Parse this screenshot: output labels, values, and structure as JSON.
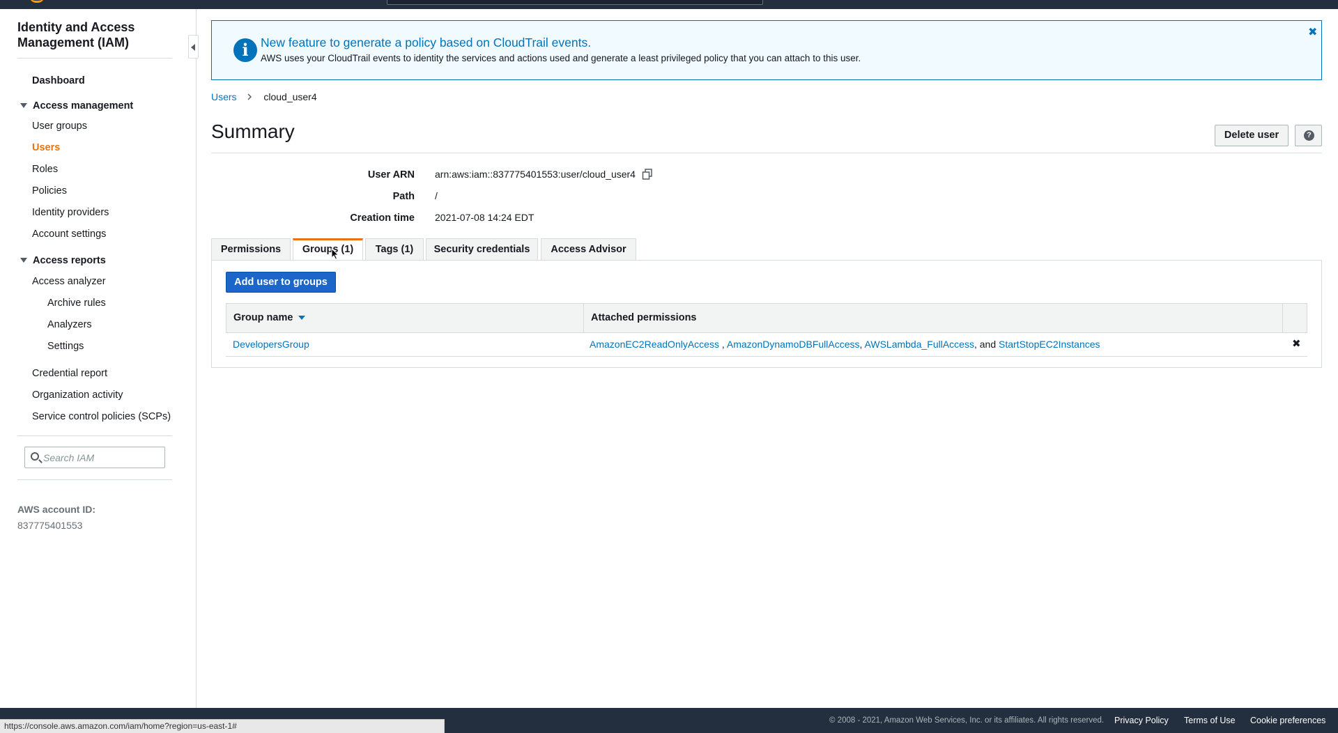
{
  "app": {
    "title": "Identity and Access Management (IAM)"
  },
  "sidebar": {
    "dashboard": "Dashboard",
    "access_management": {
      "label": "Access management",
      "items": [
        "User groups",
        "Users",
        "Roles",
        "Policies",
        "Identity providers",
        "Account settings"
      ],
      "active": "Users"
    },
    "access_reports": {
      "label": "Access reports",
      "items": [
        "Access analyzer",
        "Archive rules",
        "Analyzers",
        "Settings",
        "Credential report",
        "Organization activity",
        "Service control policies (SCPs)"
      ]
    },
    "search_placeholder": "Search IAM",
    "account_id_label": "AWS account ID:",
    "account_id": "837775401553"
  },
  "banner": {
    "title": "New feature to generate a policy based on CloudTrail events.",
    "text": "AWS uses your CloudTrail events to identity the services and actions used and generate a least privileged policy that you can attach to this user."
  },
  "breadcrumb": {
    "parent": "Users",
    "current": "cloud_user4"
  },
  "summary": {
    "title": "Summary",
    "delete_button": "Delete user",
    "help_button": "?",
    "fields": {
      "arn_label": "User ARN",
      "arn_value": "arn:aws:iam::837775401553:user/cloud_user4",
      "path_label": "Path",
      "path_value": "/",
      "created_label": "Creation time",
      "created_value": "2021-07-08 14:24 EDT"
    }
  },
  "tabs": {
    "permissions": "Permissions",
    "groups": "Groups (1)",
    "tags": "Tags (1)",
    "security": "Security credentials",
    "advisor": "Access Advisor",
    "active": "Groups (1)"
  },
  "groups_panel": {
    "add_button": "Add user to groups",
    "columns": {
      "group_name": "Group name",
      "attached": "Attached permissions"
    },
    "rows": [
      {
        "group": "DevelopersGroup",
        "policies": [
          "AmazonEC2ReadOnlyAccess",
          "AmazonDynamoDBFullAccess",
          "AWSLambda_FullAccess",
          "StartStopEC2Instances"
        ],
        "sep1": ",",
        "sep2": ",",
        "sep3": ", and",
        "remove": "✖"
      }
    ]
  },
  "footer": {
    "copyright": "© 2008 - 2021, Amazon Web Services, Inc. or its affiliates. All rights reserved.",
    "privacy": "Privacy Policy",
    "terms": "Terms of Use",
    "cookies": "Cookie preferences"
  },
  "status_bar": {
    "url": "https://console.aws.amazon.com/iam/home?region=us-east-1#"
  },
  "colors": {
    "accent": "#ec7211",
    "link": "#0073bb",
    "primary_button": "#1d66c9",
    "console_bar": "#232f3e"
  },
  "icons": {
    "info": "info-icon",
    "close": "close-icon",
    "copy": "copy-icon",
    "search": "search-icon",
    "help": "help-icon",
    "collapse": "collapse-sidebar-icon",
    "remove": "remove-icon"
  }
}
